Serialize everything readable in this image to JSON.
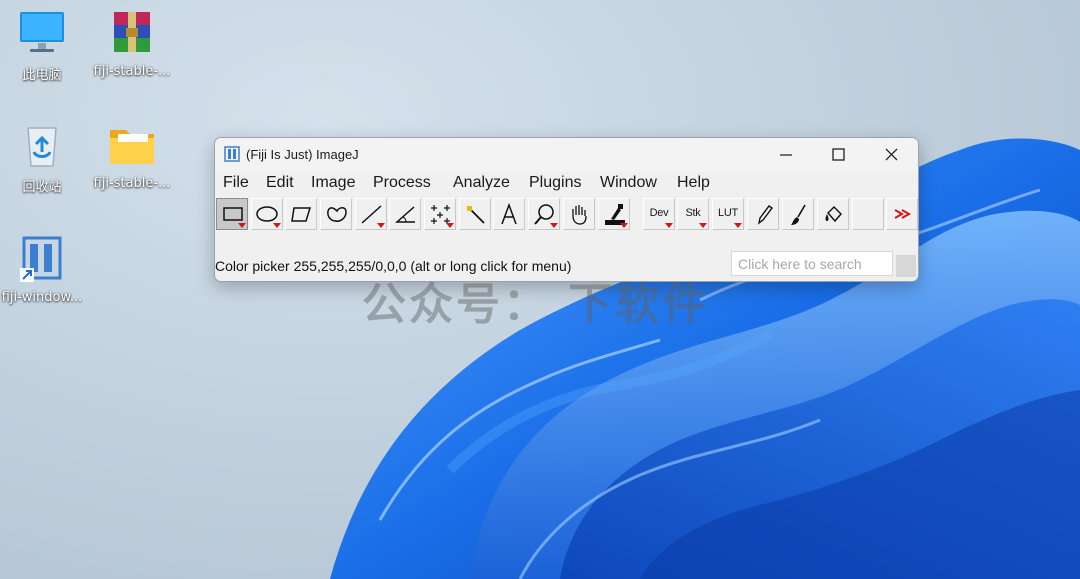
{
  "desktop": {
    "icons": [
      {
        "label": "此电脑",
        "icon": "monitor-icon"
      },
      {
        "label": "fiji-stable-...",
        "icon": "winrar-archive-icon"
      },
      {
        "label": "回收站",
        "icon": "recycle-bin-icon"
      },
      {
        "label": "fiji-stable-...",
        "icon": "folder-icon"
      },
      {
        "label": "fiji-window...",
        "icon": "fiji-shortcut-icon"
      }
    ],
    "watermark": "公众号： 下软件"
  },
  "window": {
    "title": "(Fiji Is Just) ImageJ",
    "controls": [
      "minimize-icon",
      "maximize-icon",
      "close-icon"
    ],
    "menu": [
      "File",
      "Edit",
      "Image",
      "Process",
      "Analyze",
      "Plugins",
      "Window",
      "Help"
    ],
    "tools": [
      {
        "name": "rectangle-tool",
        "text": ""
      },
      {
        "name": "oval-tool",
        "text": ""
      },
      {
        "name": "polygon-tool",
        "text": ""
      },
      {
        "name": "freehand-tool",
        "text": ""
      },
      {
        "name": "line-tool",
        "text": ""
      },
      {
        "name": "angle-tool",
        "text": ""
      },
      {
        "name": "multipoint-tool",
        "text": ""
      },
      {
        "name": "wand-tool",
        "text": ""
      },
      {
        "name": "text-tool",
        "text": ""
      },
      {
        "name": "magnifier-tool",
        "text": ""
      },
      {
        "name": "hand-tool",
        "text": ""
      },
      {
        "name": "color-picker-tool",
        "text": ""
      },
      {
        "name": "dev-tool",
        "text": "Dev"
      },
      {
        "name": "stk-tool",
        "text": "Stk"
      },
      {
        "name": "lut-tool",
        "text": "LUT"
      },
      {
        "name": "pencil-tool",
        "text": ""
      },
      {
        "name": "brush-tool",
        "text": ""
      },
      {
        "name": "flood-fill-tool",
        "text": ""
      },
      {
        "name": "more-tools",
        "text": ""
      }
    ],
    "status": "Color picker 255,255,255/0,0,0 (alt or long click for menu)",
    "search": {
      "placeholder": "Click here to search",
      "value": ""
    }
  },
  "colors": {
    "accent_red": "#d01818",
    "wallpaper_blue": "#1a6ee8",
    "window_bg": "#f0f0f0"
  }
}
